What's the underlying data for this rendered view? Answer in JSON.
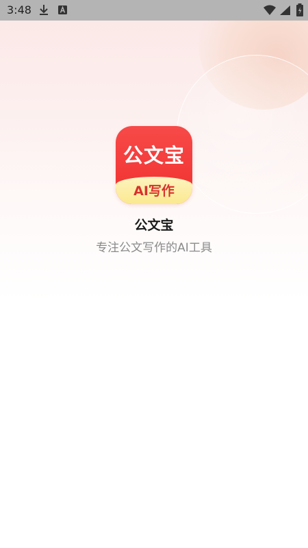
{
  "status_bar": {
    "time": "3:48",
    "icons": [
      "download-icon",
      "a-badge-icon",
      "wifi-icon",
      "signal-icon",
      "battery-icon"
    ]
  },
  "splash": {
    "icon_title": "公文宝",
    "icon_subtitle": "AI写作",
    "app_name": "公文宝",
    "tagline": "专注公文写作的AI工具"
  },
  "colors": {
    "icon_red": "#f0302f",
    "icon_ribbon": "#fbe98f",
    "tagline_gray": "#8a8a8a"
  }
}
